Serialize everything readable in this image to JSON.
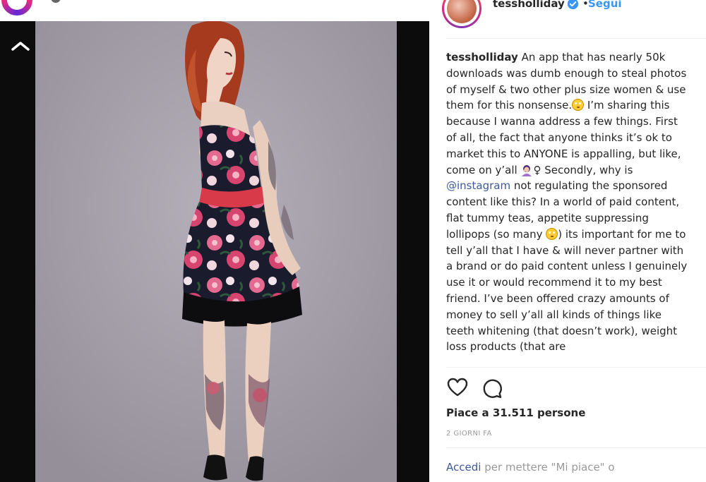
{
  "post": {
    "author": "tessholliday",
    "separator": "•",
    "follow_label": "Segui",
    "caption_user": "tessholliday",
    "caption_part1": " An app that has nearly 50k downloads was dumb enough to steal photos of myself & two other plus size women & use them for this nonsense.",
    "caption_part2": " I’m sharing this because I wanna address a few things. First of all, the fact that anyone thinks it’s ok to market this to ANYONE is appalling, but like, come on y’all ",
    "caption_part3": "♀ Secondly, why is ",
    "caption_mention": "@instagram",
    "caption_part4": " not regulating the sponsored content like this? In a world of paid content, flat tummy teas, appetite suppressing lollipops (so many ",
    "caption_part5": ") its important for me to tell y’all that I have & will never partner with a brand or do paid content unless I genuinely use it or would recommend it to my best friend. I’ve been offered crazy amounts of money to sell y’all all kinds of things like teeth whitening (that doesn’t work), weight loss products (that are",
    "likes_text": "Piace a 31.511 persone",
    "age": "2 GIORNI FA",
    "login_link": "Accedi",
    "login_rest": " per mettere \"Mi piace\" o"
  },
  "icons": [
    "site-logo",
    "collapse-chevron-icon",
    "verified-badge-icon",
    "heart-icon",
    "comment-icon",
    "rolling-eyes-emoji",
    "facepalm-emoji"
  ],
  "colors": {
    "link": "#3897f0",
    "mention": "#3c5a99",
    "text": "#262626",
    "muted": "#999999"
  }
}
